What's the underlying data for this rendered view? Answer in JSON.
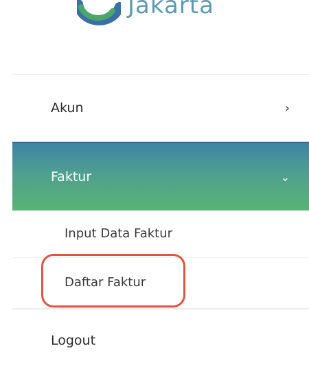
{
  "brand": {
    "name": "Jakarta",
    "logo_icon": "jakarta-logo-icon"
  },
  "menu": {
    "items": [
      {
        "label": "Akun",
        "chevron": "›",
        "expanded": false
      },
      {
        "label": "Faktur",
        "chevron": "⌄",
        "expanded": true,
        "children": [
          {
            "label": "Input Data Faktur"
          },
          {
            "label": "Daftar Faktur"
          }
        ]
      },
      {
        "label": "Logout"
      }
    ]
  },
  "colors": {
    "active_gradient_top": "#3e84a4",
    "active_gradient_bottom": "#59b474",
    "highlight": "#e4533f"
  }
}
